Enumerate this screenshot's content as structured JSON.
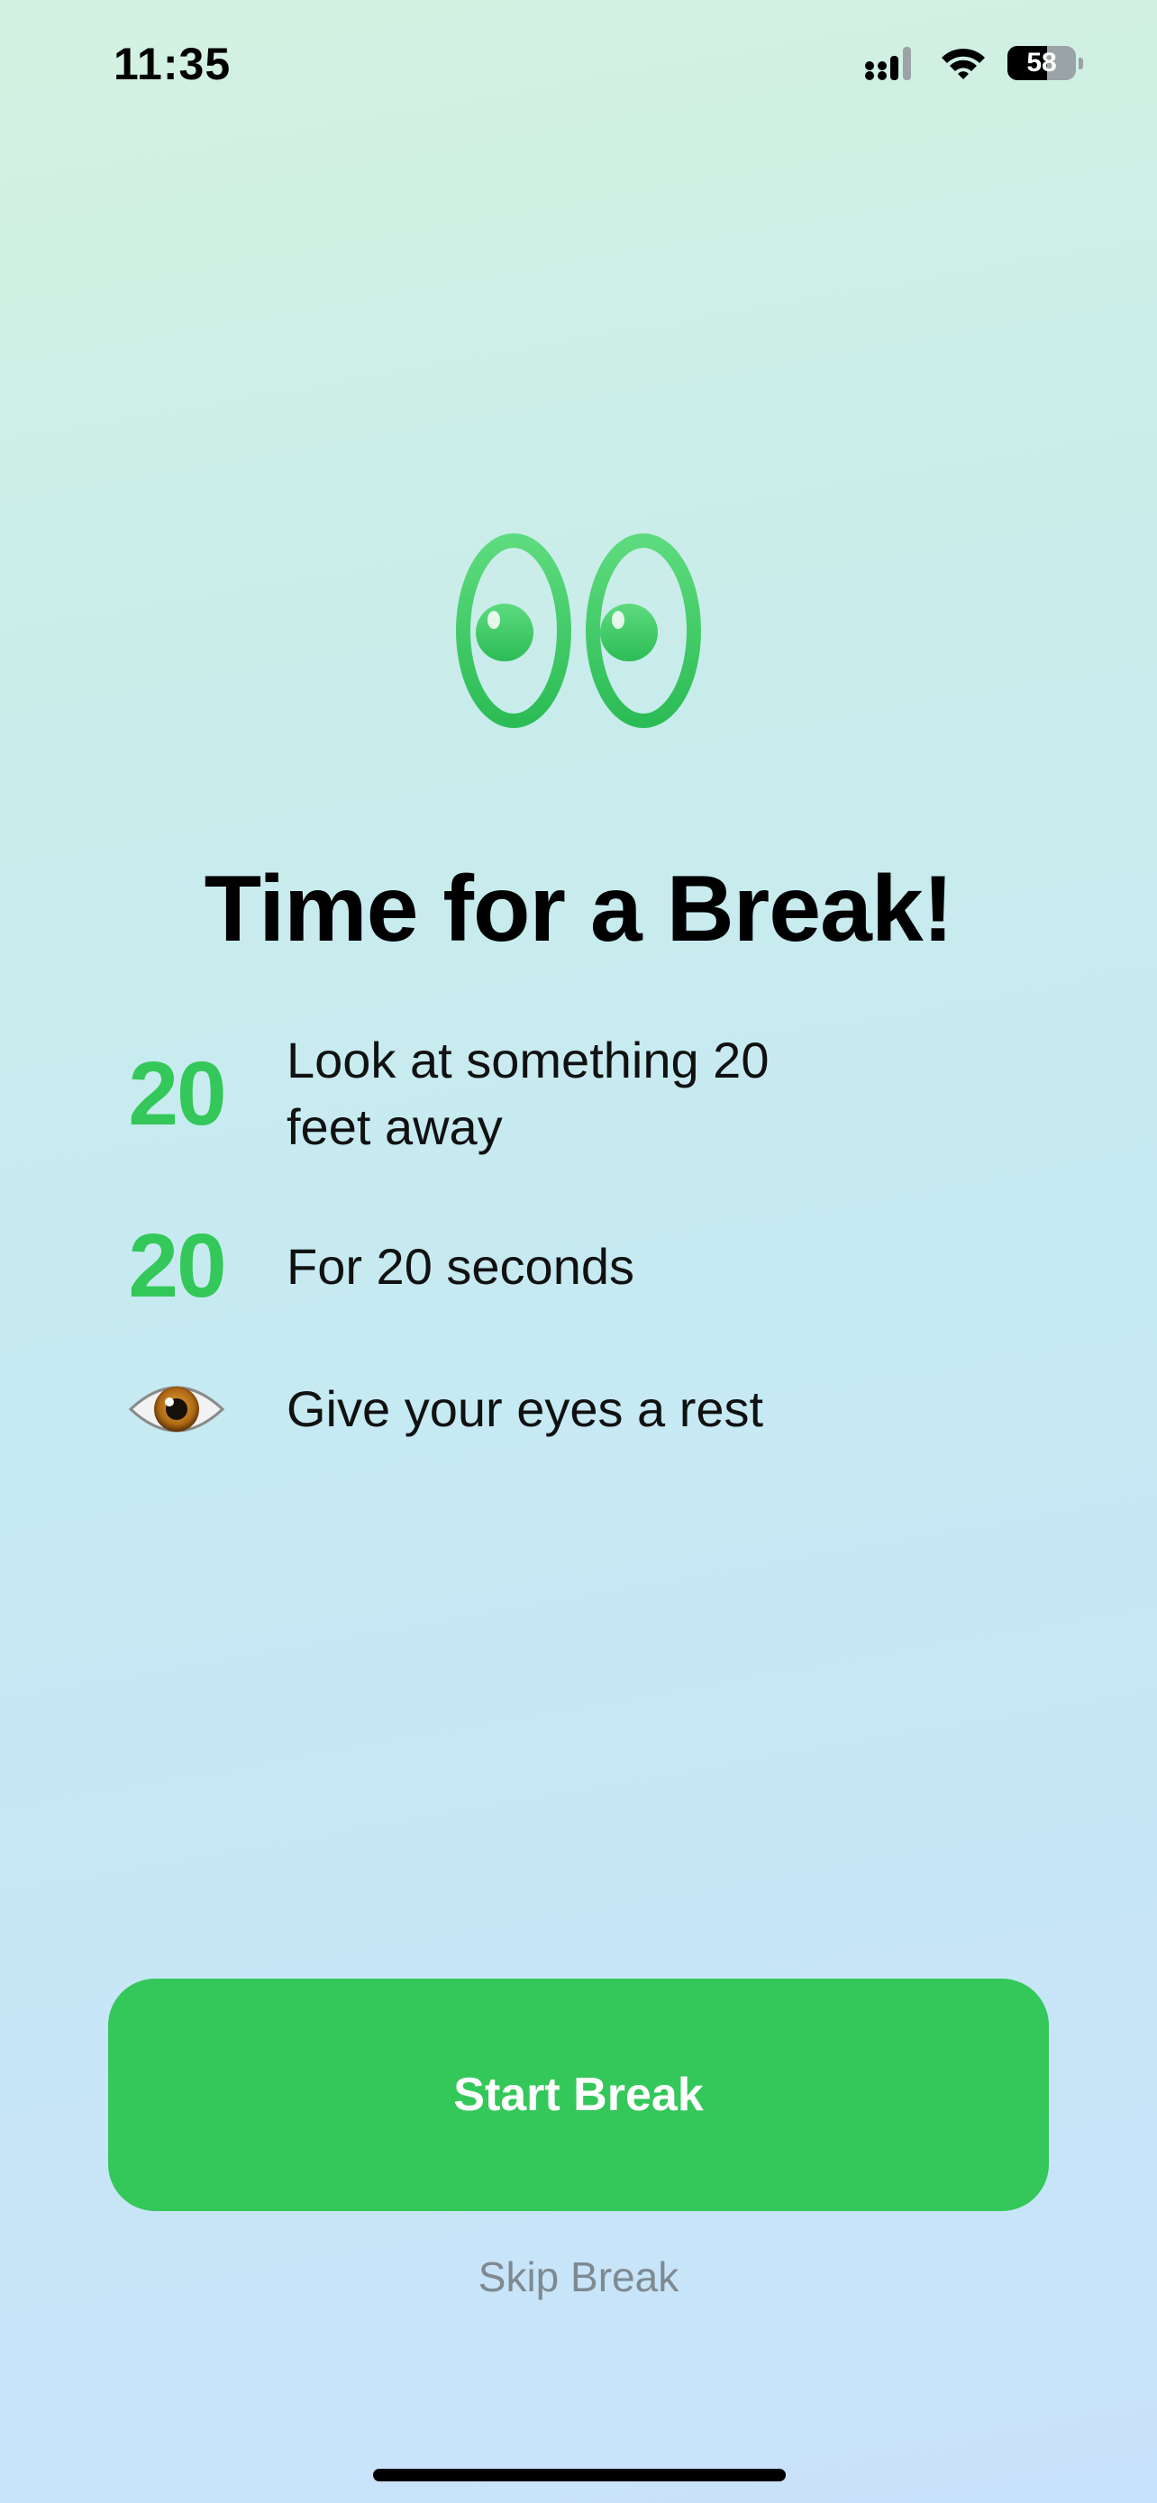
{
  "status_bar": {
    "time": "11:35",
    "battery_level": "58",
    "battery_fraction": 0.58,
    "icons": [
      "cellular-signal-icon",
      "wifi-icon",
      "battery-icon"
    ]
  },
  "hero": {
    "icon": "eyes-icon"
  },
  "title": "Time for a Break!",
  "rules": [
    {
      "number": "20",
      "text": "Look at something 20 feet away"
    },
    {
      "number": "20",
      "text": "For 20 seconds"
    },
    {
      "icon": "eye-emoji-icon",
      "text": "Give your eyes a rest"
    }
  ],
  "actions": {
    "start_label": "Start Break",
    "skip_label": "Skip Break"
  },
  "colors": {
    "accent": "#34c759",
    "secondary_text": "#7e8a92"
  }
}
